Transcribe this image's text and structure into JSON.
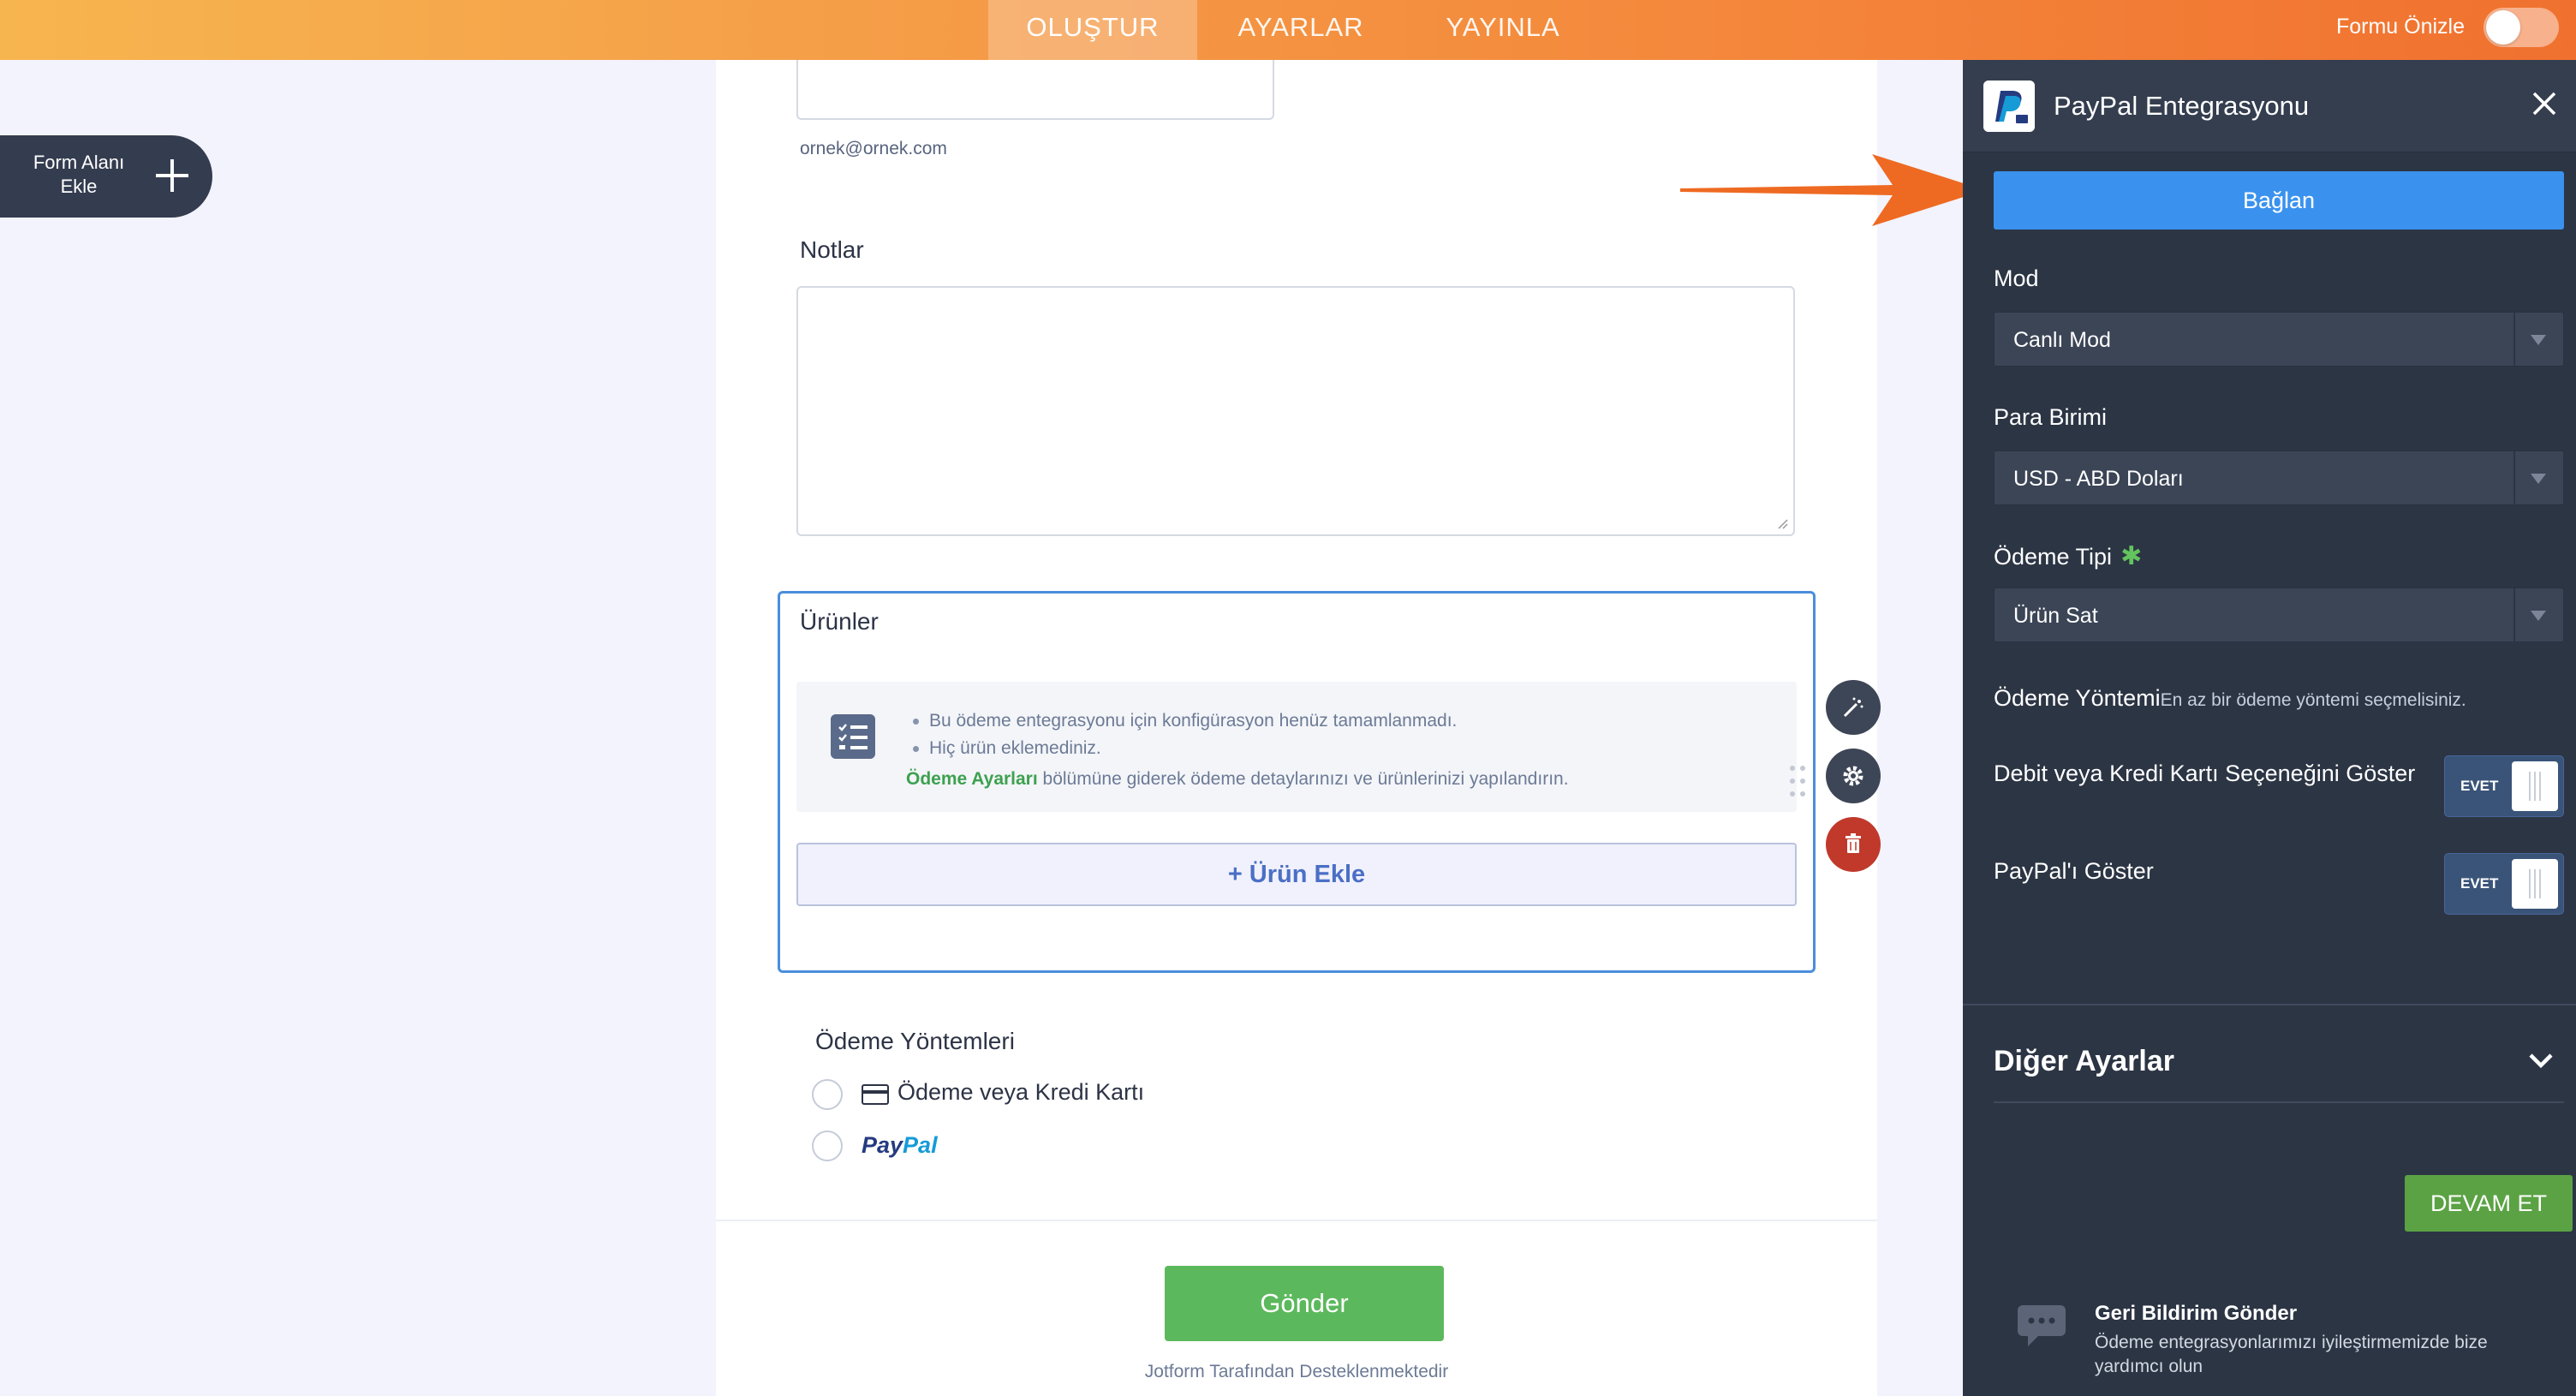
{
  "topbar": {
    "tabs": [
      {
        "label": "OLUŞTUR",
        "active": true
      },
      {
        "label": "AYARLAR",
        "active": false
      },
      {
        "label": "YAYINLA",
        "active": false
      }
    ],
    "preview_label": "Formu Önizle",
    "preview_on": false
  },
  "sidebar": {
    "add_field_label": "Form Alanı Ekle"
  },
  "form": {
    "email_sublabel": "ornek@ornek.com",
    "notes_label": "Notlar",
    "products_label": "Ürünler",
    "products_info": {
      "line1": "Bu ödeme entegrasyonu için konfigürasyon henüz tamamlanmadı.",
      "line2": "Hiç ürün eklemediniz.",
      "link_text": "Ödeme Ayarları",
      "line3_rest": " bölümüne giderek ödeme detaylarınızı ve ürünlerinizi yapılandırın."
    },
    "add_product_label": "+ Ürün Ekle",
    "payment_methods_label": "Ödeme Yöntemleri",
    "payment_options": [
      {
        "label": "Ödeme veya Kredi Kartı",
        "icon": "credit-card-icon"
      },
      {
        "label": "PayPal",
        "icon": "paypal-logo"
      }
    ],
    "paypal_logo": {
      "part1": "Pay",
      "part2": "Pal"
    },
    "submit_label": "Gönder",
    "powered_by": "Jotform Tarafından Desteklenmektedir"
  },
  "panel": {
    "title": "PayPal Entegrasyonu",
    "connect_label": "Bağlan",
    "mode": {
      "label": "Mod",
      "value": "Canlı Mod"
    },
    "currency": {
      "label": "Para Birimi",
      "value": "USD - ABD Doları"
    },
    "payment_type": {
      "label": "Ödeme Tipi",
      "value": "Ürün Sat",
      "required_mark": "✱"
    },
    "payment_method": {
      "label": "Ödeme Yöntemi",
      "note": "En az bir ödeme yöntemi seçmelisiniz."
    },
    "show_card": {
      "label": "Debit veya Kredi Kartı Seçeneğini Göster",
      "state": "EVET"
    },
    "show_paypal": {
      "label": "PayPal'ı Göster",
      "state": "EVET"
    },
    "other_settings_label": "Diğer Ayarlar",
    "continue_label": "DEVAM ET",
    "feedback": {
      "title": "Geri Bildirim Gönder",
      "text": "Ödeme entegrasyonlarımızı iyileştirmemizde bize yardımcı olun"
    }
  },
  "colors": {
    "accent_blue": "#3a92ee",
    "panel_bg": "#2c3544",
    "success_green": "#5cb85c",
    "arrow_orange": "#ee6a22"
  }
}
